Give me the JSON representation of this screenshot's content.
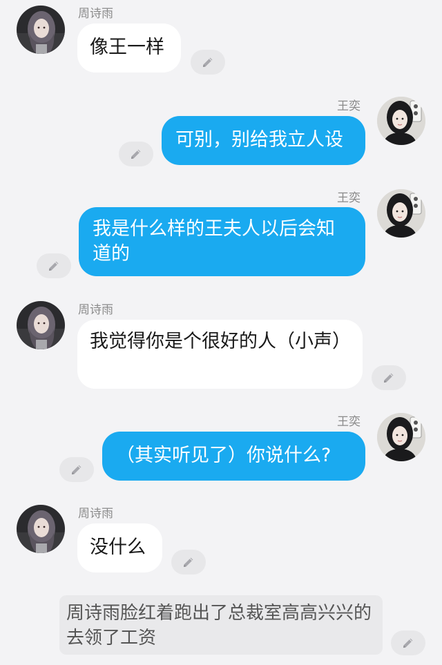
{
  "messages": [
    {
      "sender": "周诗雨",
      "side": "left",
      "text": "像王一样"
    },
    {
      "sender": "王奕",
      "side": "right",
      "text": "可别，别给我立人设"
    },
    {
      "sender": "王奕",
      "side": "right",
      "text": "我是什么样的王夫人以后会知道的"
    },
    {
      "sender": "周诗雨",
      "side": "left",
      "text": "我觉得你是个很好的人（小声）"
    },
    {
      "sender": "王奕",
      "side": "right",
      "text": "（其实听见了）你说什么?"
    },
    {
      "sender": "周诗雨",
      "side": "left",
      "text": "没什么"
    }
  ],
  "narration": {
    "text": "周诗雨脸红着跑出了总裁室高高兴兴的去领了工资"
  },
  "icons": {
    "edit": "pencil-icon",
    "avatar_left": "avatar-zhou-shiyu",
    "avatar_right": "avatar-wang-yi"
  },
  "colors": {
    "right_bubble": "#1aaaf0",
    "left_bubble": "#ffffff",
    "background": "#f3f3f5",
    "narration_bg": "#e9e9eb"
  }
}
